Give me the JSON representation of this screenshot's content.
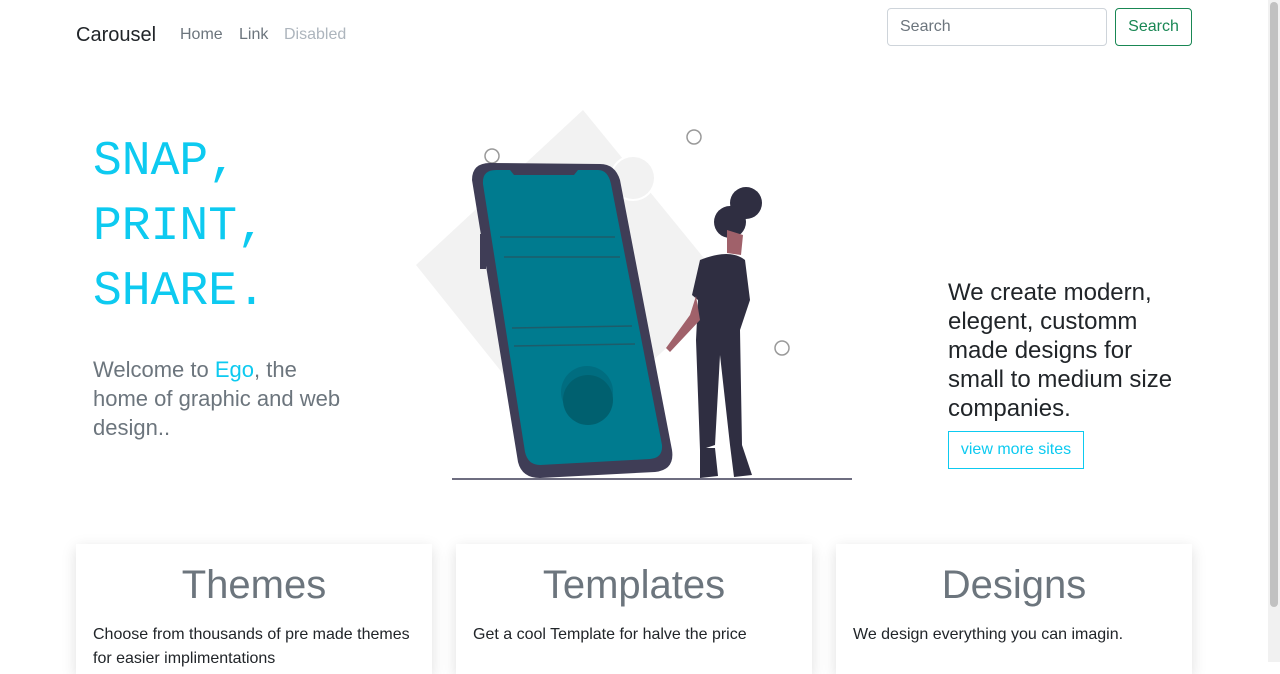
{
  "nav": {
    "brand": "Carousel",
    "links": [
      "Home",
      "Link",
      "Disabled"
    ],
    "search_placeholder": "Search",
    "search_button": "Search"
  },
  "hero": {
    "lines": [
      "SNAP,",
      "PRINT,",
      "SHARE."
    ],
    "welcome_pre": "Welcome to ",
    "welcome_brand": "Ego",
    "welcome_post": ", the home of graphic and web design..",
    "tagline": "We create modern, elegent, customm made designs for small to medium size companies.",
    "cta": "view more sites"
  },
  "colors": {
    "accent": "#0dcaf0",
    "success": "#198754",
    "phone_screen": "#007b8f",
    "dark": "#2f2e41"
  },
  "cards": [
    {
      "title": "Themes",
      "text": "Choose from thousands of pre made themes for easier implimentations"
    },
    {
      "title": "Templates",
      "text": "Get a cool Template for halve the price"
    },
    {
      "title": "Designs",
      "text": "We design everything you can imagin."
    }
  ]
}
